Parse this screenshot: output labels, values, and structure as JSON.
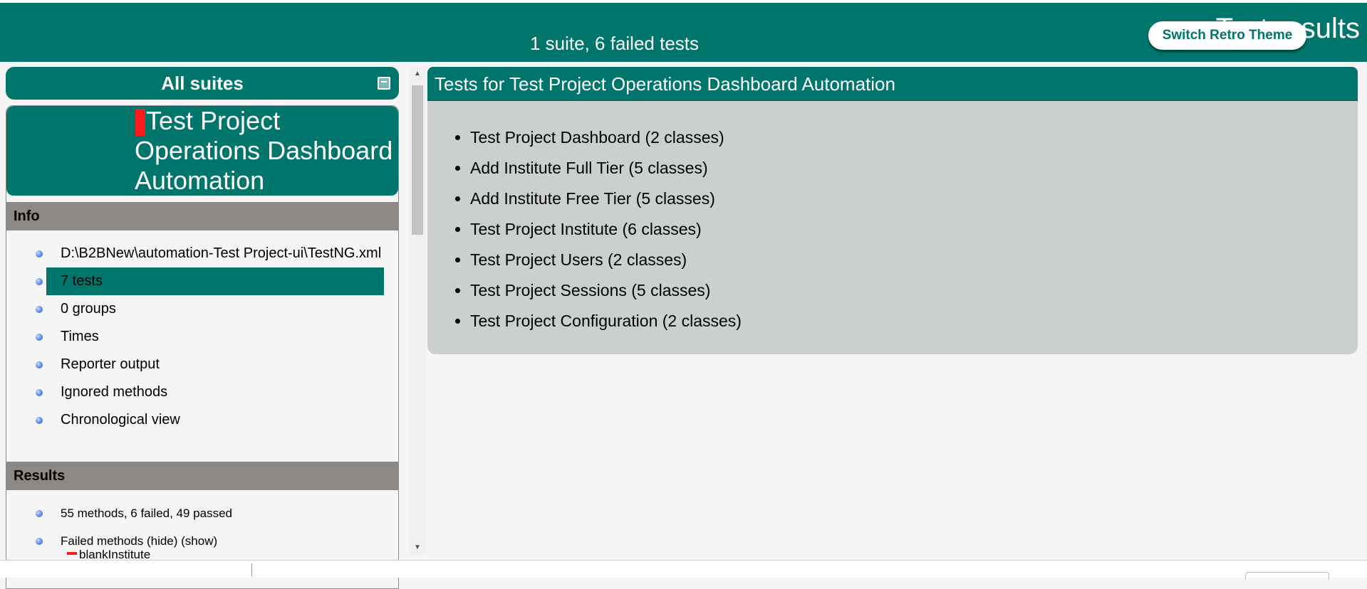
{
  "header": {
    "summary": "1 suite, 6 failed tests",
    "results_title": "Test results",
    "theme_button_label": "Switch Retro Theme"
  },
  "sidebar": {
    "all_suites_label": "All suites",
    "suite_name": "Test Project Operations Dashboard Automation",
    "info": {
      "heading": "Info",
      "items": [
        {
          "label": "D:\\B2BNew\\automation-Test Project-ui\\TestNG.xml"
        },
        {
          "label": "7 tests"
        },
        {
          "label": "0 groups"
        },
        {
          "label": "Times"
        },
        {
          "label": "Reporter output"
        },
        {
          "label": "Ignored methods"
        },
        {
          "label": "Chronological view"
        }
      ]
    },
    "results": {
      "heading": "Results",
      "items": [
        {
          "label": "55 methods, 6 failed, 49 passed"
        },
        {
          "label": "Failed methods (hide) (show)"
        }
      ],
      "partial_item": "blankInstitute"
    }
  },
  "main": {
    "title": "Tests for Test Project Operations Dashboard Automation",
    "tests": [
      {
        "label": "Test Project Dashboard (2 classes)"
      },
      {
        "label": "Add Institute Full Tier (5 classes)"
      },
      {
        "label": "Add Institute Free Tier (5 classes)"
      },
      {
        "label": "Test Project Institute (6 classes)"
      },
      {
        "label": "Test Project Users (2 classes)"
      },
      {
        "label": "Test Project Sessions (5 classes)"
      },
      {
        "label": "Test Project Configuration (2 classes)"
      }
    ]
  },
  "colors": {
    "primary": "#00756b",
    "section_header": "#8c8886",
    "content_bg": "#cbcfcf",
    "fail_marker": "#ff1a1a"
  }
}
